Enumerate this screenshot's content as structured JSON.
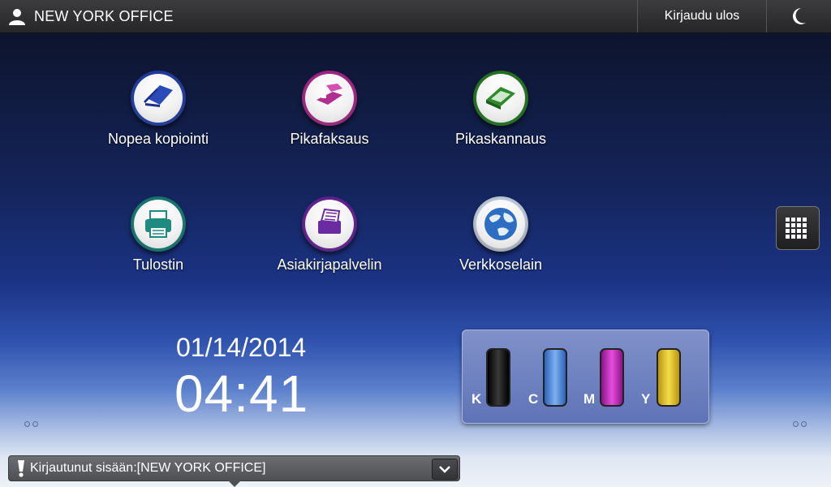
{
  "header": {
    "user_icon": "user-icon",
    "title": "NEW YORK OFFICE",
    "logout_label": "Kirjaudu ulos",
    "sleep_icon": "moon-icon"
  },
  "apps": [
    {
      "label": "Nopea kopiointi",
      "icon": "copy-icon",
      "color": "#2a4bb8"
    },
    {
      "label": "Pikafaksaus",
      "icon": "fax-icon",
      "color": "#b02f91"
    },
    {
      "label": "Pikaskannaus",
      "icon": "scanner-icon",
      "color": "#2f8a2d"
    },
    {
      "label": "Tulostin",
      "icon": "printer-icon",
      "color": "#1f8a80"
    },
    {
      "label": "Asiakirjapalvelin",
      "icon": "document-server-icon",
      "color": "#6a2aa0"
    },
    {
      "label": "Verkkoselain",
      "icon": "globe-icon",
      "color": "#2c6fc2"
    }
  ],
  "datetime": {
    "date": "01/14/2014",
    "time": "04:41"
  },
  "toner": [
    {
      "letter": "K",
      "color": "#111111"
    },
    {
      "letter": "C",
      "color": "#3a7fd6"
    },
    {
      "letter": "M",
      "color": "#b521b0"
    },
    {
      "letter": "Y",
      "color": "#e6c419"
    }
  ],
  "status": {
    "text": "Kirjautunut sisään:[NEW YORK OFFICE]",
    "icon": "exclamation-icon",
    "expand_icon": "chevron-down-icon"
  },
  "apps_grid_icon": "grid-icon"
}
